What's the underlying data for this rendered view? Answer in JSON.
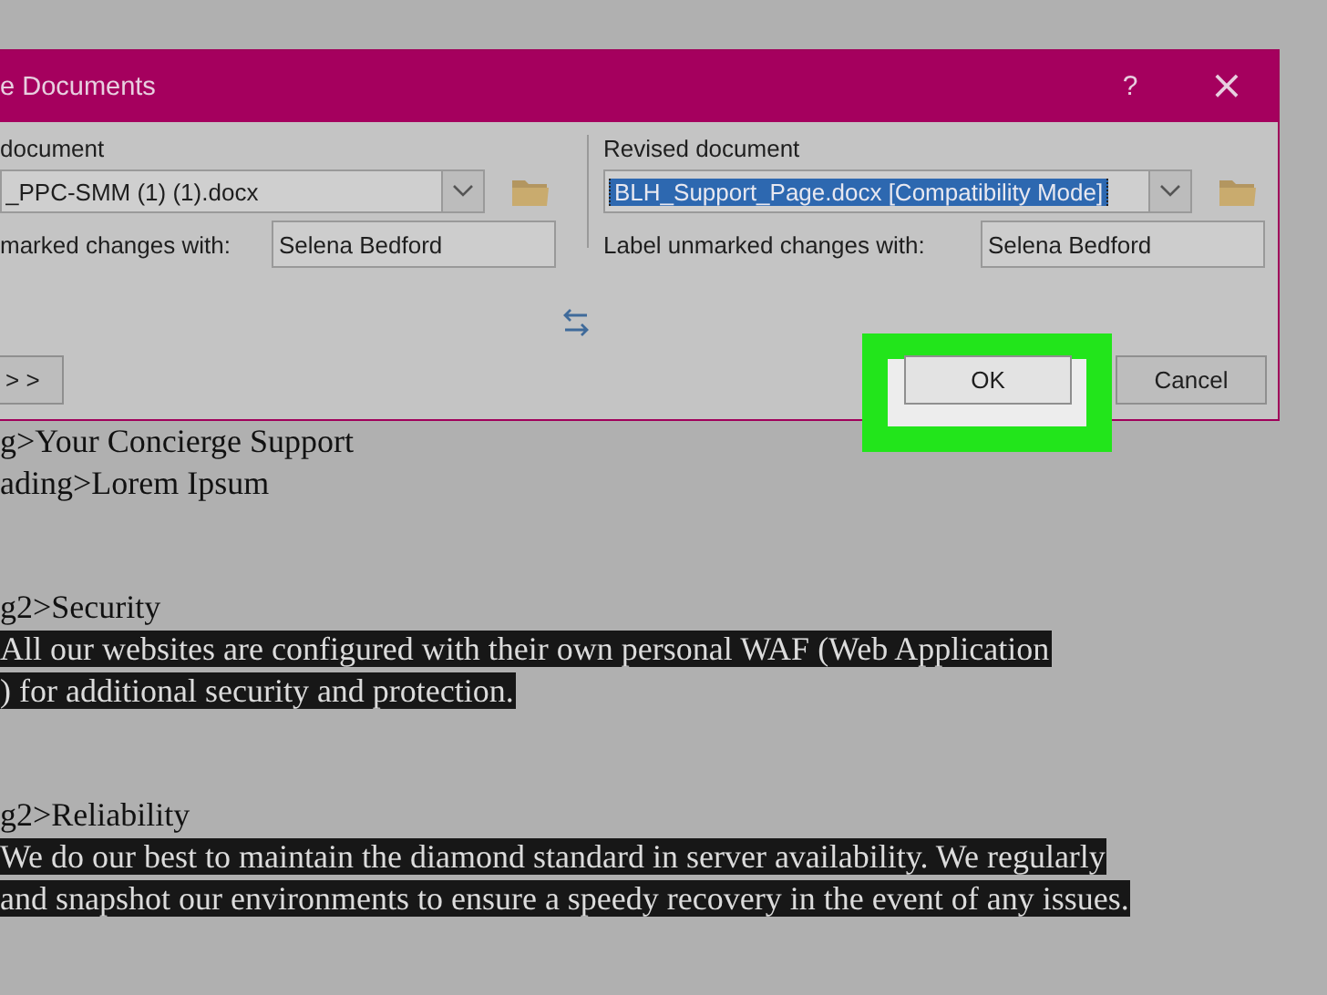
{
  "dialog": {
    "title": "e Documents",
    "help_button": "?",
    "close_button": "×",
    "original": {
      "label": "document",
      "file": "_PPC-SMM (1) (1).docx",
      "label_changes": "marked changes with:",
      "author": "Selena Bedford"
    },
    "revised": {
      "label": "Revised document",
      "file": "BLH_Support_Page.docx [Compatibility Mode]",
      "file_selected": true,
      "label_changes": "Label unmarked changes with:",
      "author": "Selena Bedford"
    },
    "more_button": "> >",
    "ok_button": "OK",
    "ok_highlighted": true,
    "cancel_button": "Cancel"
  },
  "document": {
    "paragraphs": [
      [
        {
          "text": "g>Your Concierge Support",
          "highlighted": false
        },
        {
          "text": "ading>Lorem Ipsum",
          "highlighted": false
        }
      ],
      [
        {
          "text": "g2>Security",
          "highlighted": false
        },
        {
          "text": "All our websites are configured with their own personal WAF (Web Application",
          "highlighted": true
        },
        {
          "text": ") for additional security and protection.",
          "highlighted": true
        }
      ],
      [
        {
          "text": "g2>Reliability",
          "highlighted": false
        },
        {
          "text": "We do our best to maintain the diamond standard in server availability. We regularly",
          "highlighted": true
        },
        {
          "text": "and snapshot our environments to ensure a speedy recovery in the event of any issues.",
          "highlighted": true
        }
      ]
    ]
  }
}
